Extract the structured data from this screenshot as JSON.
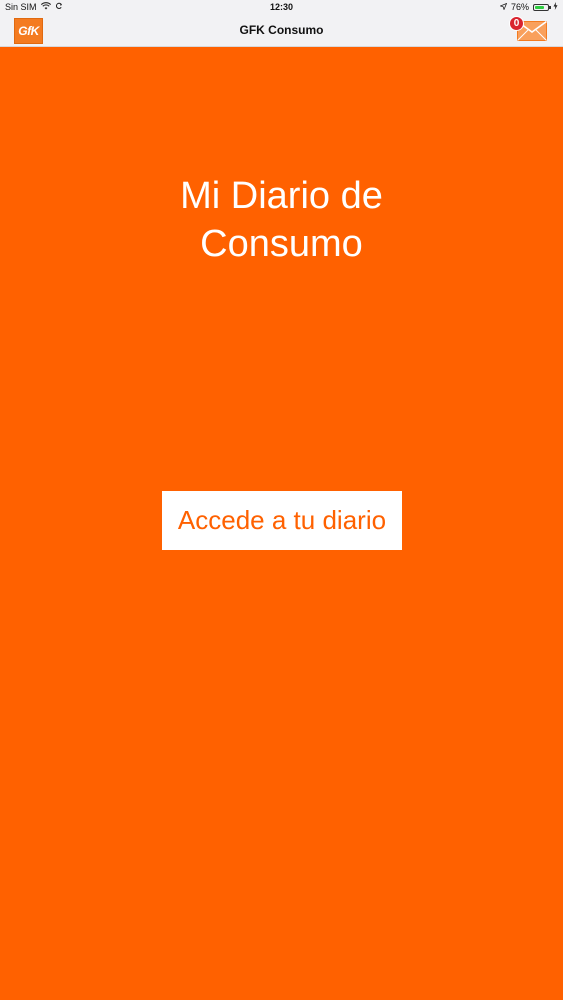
{
  "status_bar": {
    "carrier": "Sin SIM",
    "time": "12:30",
    "battery_percent": "76%",
    "battery_level": 0.76
  },
  "nav_bar": {
    "logo_text": "GfK",
    "title": "GFK Consumo",
    "mail_badge_count": "0"
  },
  "main": {
    "title_line1": "Mi Diario de",
    "title_line2": "Consumo",
    "access_button_label": "Accede a tu diario"
  },
  "colors": {
    "background": "#ff6100",
    "button_background": "#ffffff",
    "button_text": "#ff6100",
    "bar_background": "#f2f2f4",
    "badge": "#d9232e"
  }
}
